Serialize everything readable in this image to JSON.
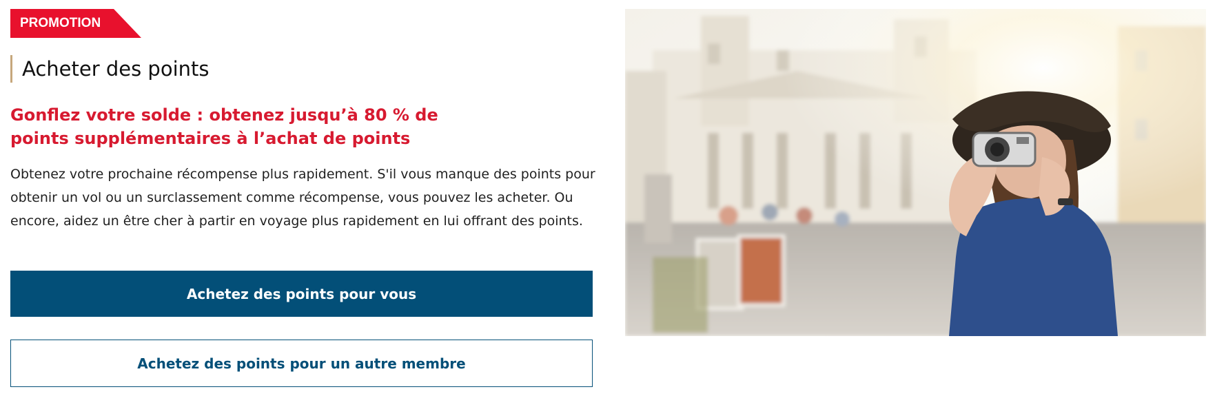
{
  "promo": {
    "badge_label": "PROMOTION"
  },
  "section": {
    "title": "Acheter des points"
  },
  "headline": "Gonflez votre solde : obtenez jusqu’à 80 % de points supplémentaires à l’achat de points",
  "description": "Obtenez votre prochaine récompense plus rapidement. S'il vous manque des points pour obtenir un vol ou un surclassement comme récompense, vous pouvez les acheter. Ou encore, aidez un être cher à partir en voyage plus rapidement en lui offrant des points.",
  "buttons": {
    "buy_for_you": "Achetez des points pour vous",
    "buy_for_other": "Achetez des points pour un autre membre"
  },
  "colors": {
    "promo_red": "#e8112d",
    "headline_red": "#d71a30",
    "primary_blue": "#034f78",
    "title_accent": "#c6a77c"
  }
}
